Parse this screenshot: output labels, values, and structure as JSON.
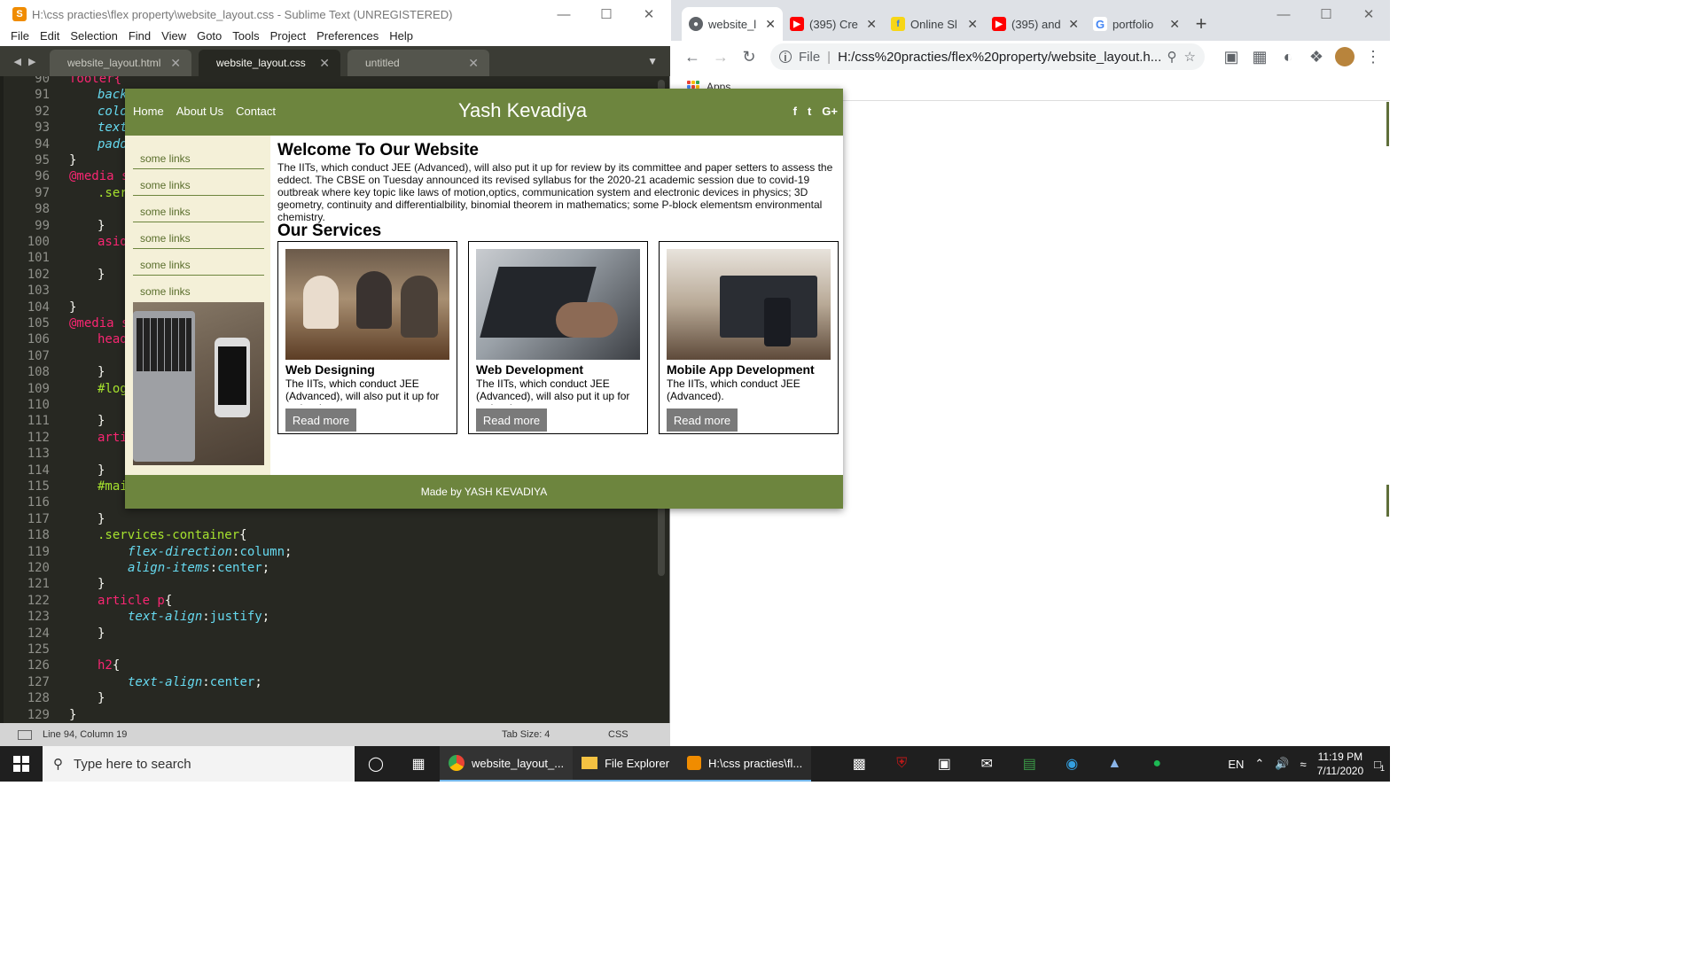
{
  "sublime": {
    "title": "H:\\css practies\\flex property\\website_layout.css - Sublime Text (UNREGISTERED)",
    "menu": [
      "File",
      "Edit",
      "Selection",
      "Find",
      "View",
      "Goto",
      "Tools",
      "Project",
      "Preferences",
      "Help"
    ],
    "tabs": [
      {
        "label": "website_layout.html",
        "active": false
      },
      {
        "label": "website_layout.css",
        "active": true
      },
      {
        "label": "untitled",
        "active": false
      }
    ],
    "line_numbers": [
      "90",
      "91",
      "92",
      "93",
      "94",
      "95",
      "96",
      "97",
      "98",
      "99",
      "100",
      "101",
      "102",
      "103",
      "104",
      "105",
      "106",
      "107",
      "108",
      "109",
      "110",
      "111",
      "112",
      "113",
      "114",
      "115",
      "116",
      "117",
      "118",
      "119",
      "120",
      "121",
      "122",
      "123",
      "124",
      "125",
      "126",
      "127",
      "128",
      "129"
    ],
    "code": {
      "l90": "footer{",
      "l91": "back",
      "l92": "colo",
      "l93": "text",
      "l94": "padd",
      "l95": "}",
      "l96": "@media s",
      "l97": ".ser",
      "l99": "}",
      "l100": "asid",
      "l102": "}",
      "l104": "}",
      "l105": "@media s",
      "l106": "head",
      "l108": "}",
      "l109": "#log",
      "l111": "}",
      "l112": "arti",
      "l114": "}",
      "l115": "#mai",
      "l117": "}",
      "l118_sel": ".services-container",
      "l118_brace": "{",
      "l119_prop": "flex-direction",
      "l119_val": "column",
      "l120_prop": "align-items",
      "l120_val": "center",
      "l121": "}",
      "l122_sel": "article p",
      "l122_brace": "{",
      "l123_prop": "text-align",
      "l123_val": "justify",
      "l124": "}",
      "l126_sel": "h2",
      "l126_brace": "{",
      "l127_prop": "text-align",
      "l127_val": "center",
      "l128": "}",
      "l129": "}"
    },
    "status": {
      "position": "Line 94, Column 19",
      "tab_size": "Tab Size: 4",
      "syntax": "CSS"
    }
  },
  "chrome": {
    "tabs": [
      {
        "label": "website_l",
        "icon": "globe-icon",
        "active": true
      },
      {
        "label": "(395) Cre",
        "icon": "youtube-icon",
        "active": false
      },
      {
        "label": "Online Sl",
        "icon": "flipkart-icon",
        "active": false
      },
      {
        "label": "(395) and",
        "icon": "youtube-icon",
        "active": false
      },
      {
        "label": "portfolio",
        "icon": "google-icon",
        "active": false
      }
    ],
    "omnibox": {
      "scheme": "File",
      "url": "H:/css%20practies/flex%20property/website_layout.h..."
    },
    "bookmarks": {
      "apps": "Apps"
    }
  },
  "site": {
    "nav": [
      "Home",
      "About Us",
      "Contact"
    ],
    "logo": "Yash Kevadiya",
    "social": [
      "f",
      "t",
      "G+"
    ],
    "aside_links": [
      "some links",
      "some links",
      "some links",
      "some links",
      "some links",
      "some links"
    ],
    "welcome_title": "Welcome To Our Website",
    "welcome_text": "The IITs, which conduct JEE (Advanced), will also put it up for review by its committee and paper setters to assess the eddect. The CBSE on Tuesday announced its revised syllabus for the 2020-21 academic session due to covid-19 outbreak where key topic like laws of motion,optics, communication system and electronic devices in physics; 3D geometry, continuity and differentialbility, binomial theorem in mathematics; some P-block elementsm environmental chemistry.",
    "services_title": "Our Services",
    "cards": [
      {
        "title": "Web Designing",
        "text": "The IITs, which conduct JEE (Advanced), will also put it up for review by",
        "button": "Read more"
      },
      {
        "title": "Web Development",
        "text": "The IITs, which conduct JEE (Advanced), will also put it up for review by",
        "button": "Read more"
      },
      {
        "title": "Mobile App Development",
        "text": "The IITs, which conduct JEE (Advanced).",
        "button": "Read more"
      }
    ],
    "footer": "Made by YASH KEVADIYA"
  },
  "taskbar": {
    "search_placeholder": "Type here to search",
    "apps": [
      {
        "label": "website_layout_...",
        "icon": "chrome-icon"
      },
      {
        "label": "File Explorer",
        "icon": "folder-icon"
      },
      {
        "label": "H:\\css practies\\fl...",
        "icon": "sublime-icon"
      }
    ],
    "lang": "EN",
    "time": "11:19 PM",
    "date": "7/11/2020",
    "notifications": "1"
  }
}
